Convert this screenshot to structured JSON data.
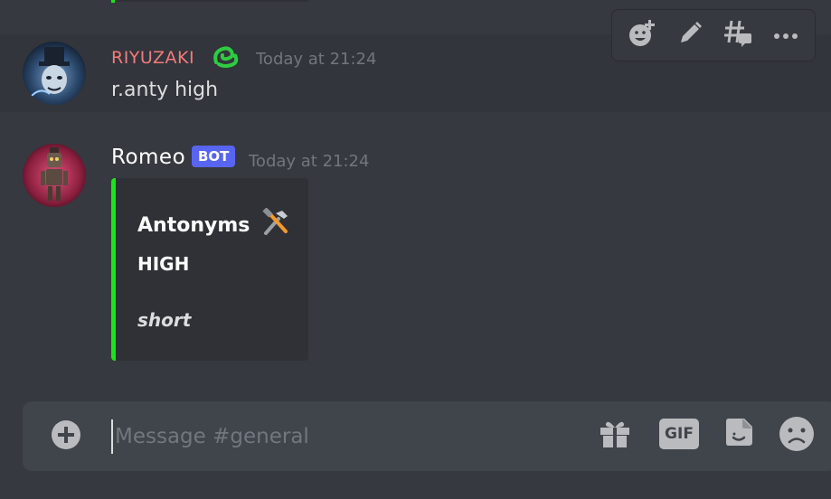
{
  "previous_message": {},
  "messages": [
    {
      "username": "RIYUZAKI",
      "username_color": "#f47b7b",
      "badge_emoji_icon": "green-snake-icon",
      "timestamp": "Today at 21:24",
      "content": "r.anty high"
    },
    {
      "username": "Romeo",
      "username_color": "#ffffff",
      "bot_tag": "BOT",
      "timestamp": "Today at 21:24",
      "embed": {
        "title": "Antonyms",
        "title_icon": "hammer-and-wrench-icon",
        "field_name": "HIGH",
        "field_value": "short",
        "accent_color": "#1ce31c"
      }
    }
  ],
  "hover_toolbar": {
    "buttons": [
      "add-reaction-icon",
      "edit-icon",
      "create-thread-icon",
      "more-icon"
    ]
  },
  "composer": {
    "placeholder": "Message #general",
    "icons": [
      "upload-plus-icon",
      "gift-icon",
      "gif-icon",
      "sticker-icon",
      "emoji-icon"
    ],
    "gif_label": "GIF"
  },
  "colors": {
    "background": "#36393f",
    "hover_background": "#32353b",
    "embed_background": "#2f3136",
    "bot_tag": "#5865f2",
    "composer": "#40444b"
  }
}
